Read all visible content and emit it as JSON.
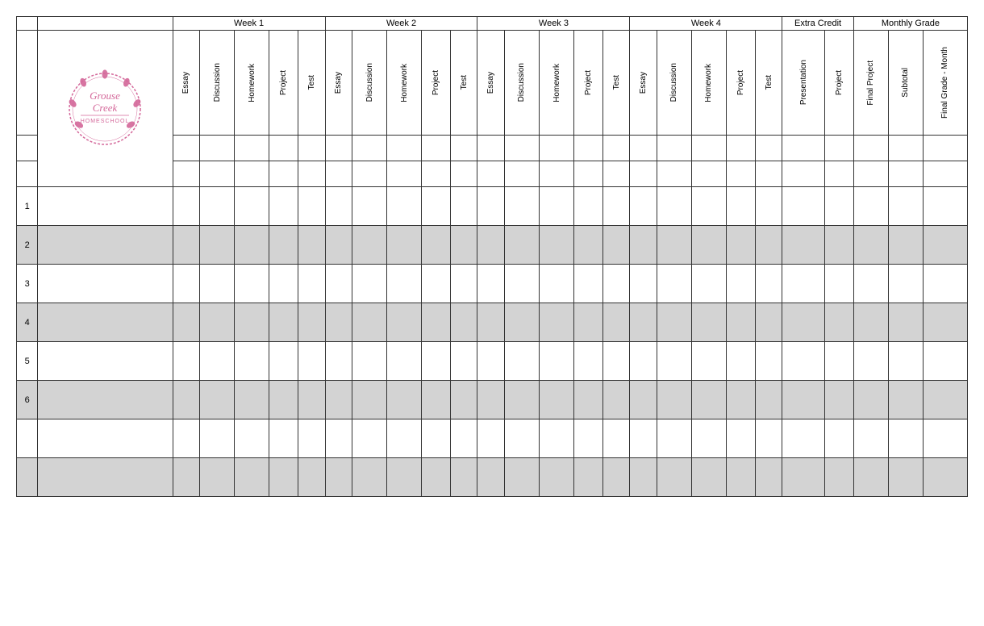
{
  "table": {
    "week_headers": [
      "Week 1",
      "Week 2",
      "Week 3",
      "Week 4",
      "Extra Credit",
      "Monthly Grade"
    ],
    "col_headers": [
      "Essay",
      "Discussion",
      "Homework",
      "Project",
      "Test"
    ],
    "extra_credit_cols": [
      "Presentation",
      "Project"
    ],
    "monthly_grade_cols": [
      "Final Project",
      "Subtotal",
      "Final Grade - Month"
    ],
    "row_numbers": [
      "1",
      "2",
      "3",
      "4",
      "5",
      "6",
      "",
      ""
    ],
    "data_rows": 8
  },
  "logo": {
    "line1": "Grouse",
    "line2": "Creek",
    "line3": "HOMESCHOOL"
  }
}
